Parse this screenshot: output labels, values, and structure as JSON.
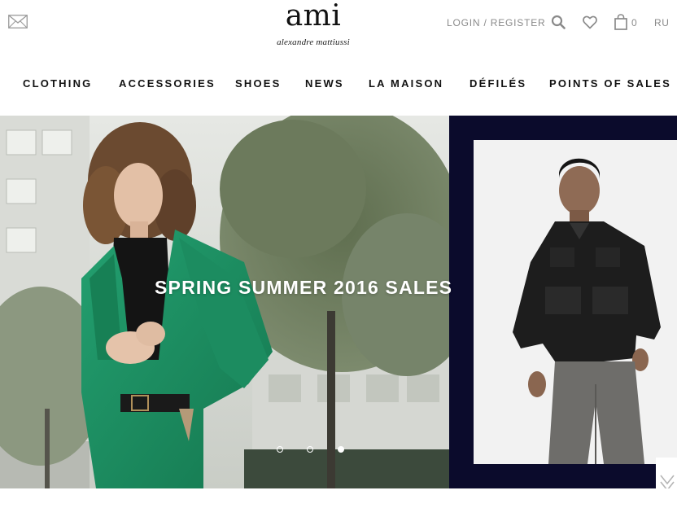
{
  "header": {
    "mail_icon": "envelope-icon",
    "logo": {
      "main": "ami",
      "sub": "alexandre mattiussi"
    },
    "login_label": "LOGIN / REGISTER",
    "search_icon": "search-icon",
    "wishlist_icon": "heart-icon",
    "bag_icon": "shopping-bag-icon",
    "bag_count": "0",
    "language": "RU"
  },
  "nav": {
    "items": [
      {
        "label": "CLOTHING"
      },
      {
        "label": "ACCESSORIES"
      },
      {
        "label": "SHOES"
      },
      {
        "label": "NEWS"
      },
      {
        "label": "LA MAISON"
      },
      {
        "label": "DÉFILÉS"
      },
      {
        "label": "POINTS OF SALES"
      }
    ]
  },
  "hero": {
    "title": "SPRING SUMMER 2016 SALES",
    "slides_total": 3,
    "active_slide": 3,
    "next_icon": "chevron-down-icon",
    "colors": {
      "right_panel_bg": "#0b0b2c",
      "coat": "#1f8f62"
    }
  }
}
